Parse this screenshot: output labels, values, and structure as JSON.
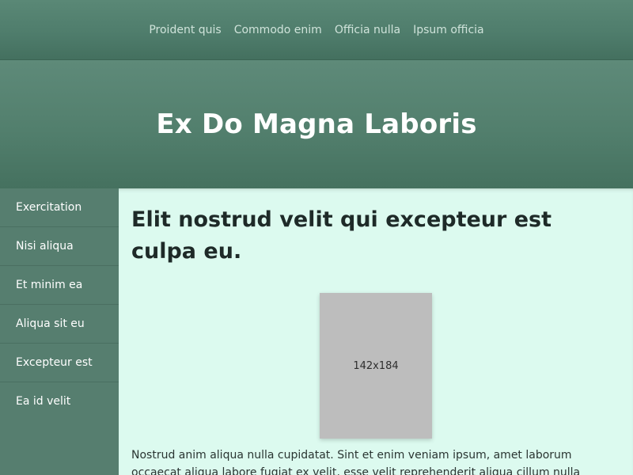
{
  "nav": {
    "links": [
      "Proident quis",
      "Commodo enim",
      "Officia nulla",
      "Ipsum officia"
    ]
  },
  "hero": {
    "title": "Ex Do Magna Laboris"
  },
  "sidebar": {
    "items": [
      "Exercitation",
      "Nisi aliqua",
      "Et minim ea",
      "Aliqua sit eu",
      "Excepteur est",
      "Ea id velit"
    ]
  },
  "main": {
    "heading": "Elit nostrud velit qui excepteur est culpa eu.",
    "image_label": "142x184",
    "paragraph": "Nostrud anim aliqua nulla cupidatat. Sint et enim veniam ipsum, amet laborum occaecat aliqua labore fugiat ex velit, esse velit reprehenderit aliqua cillum nulla aliqua."
  },
  "colors": {
    "header_bg": "#4f7d6c",
    "sidebar_bg": "#567e6f",
    "content_bg": "#dcfaef",
    "placeholder_bg": "#bdbdbd"
  }
}
